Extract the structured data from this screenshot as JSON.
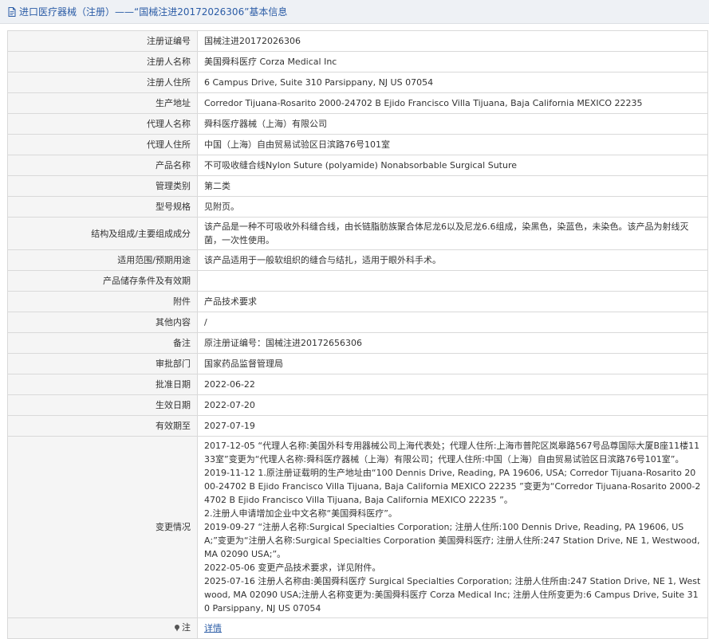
{
  "header": {
    "title": "进口医疗器械（注册）——“国械注进20172026306”基本信息"
  },
  "rows": [
    {
      "label": "注册证编号",
      "value": "国械注进20172026306"
    },
    {
      "label": "注册人名称",
      "value": "美国舜科医疗 Corza Medical Inc"
    },
    {
      "label": "注册人住所",
      "value": "6 Campus Drive, Suite 310 Parsippany, NJ US 07054"
    },
    {
      "label": "生产地址",
      "value": "Corredor Tijuana-Rosarito 2000-24702 B Ejido Francisco Villa Tijuana, Baja California MEXICO 22235"
    },
    {
      "label": "代理人名称",
      "value": "舜科医疗器械（上海）有限公司"
    },
    {
      "label": "代理人住所",
      "value": "中国（上海）自由贸易试验区日滨路76号101室"
    },
    {
      "label": "产品名称",
      "value": "不可吸收缝合线Nylon Suture (polyamide) Nonabsorbable Surgical Suture"
    },
    {
      "label": "管理类别",
      "value": "第二类"
    },
    {
      "label": "型号规格",
      "value": "见附页。"
    },
    {
      "label": "结构及组成/主要组成成分",
      "value": "该产品是一种不可吸收外科缝合线，由长链脂肪族聚合体尼龙6以及尼龙6.6组成，染黑色，染蓝色，未染色。该产品为射线灭菌，一次性使用。"
    },
    {
      "label": "适用范围/预期用途",
      "value": "该产品适用于一般软组织的缝合与结扎，适用于眼外科手术。"
    },
    {
      "label": "产品储存条件及有效期",
      "value": ""
    },
    {
      "label": "附件",
      "value": "产品技术要求"
    },
    {
      "label": "其他内容",
      "value": "/"
    },
    {
      "label": "备注",
      "value": "原注册证编号：国械注进20172656306"
    },
    {
      "label": "审批部门",
      "value": "国家药品监督管理局"
    },
    {
      "label": "批准日期",
      "value": "2022-06-22"
    },
    {
      "label": "生效日期",
      "value": "2022-07-20"
    },
    {
      "label": "有效期至",
      "value": "2027-07-19"
    }
  ],
  "changes": {
    "label": "变更情况",
    "lines": [
      "2017-12-05 “代理人名称:美国外科专用器械公司上海代表处；代理人住所:上海市普陀区岚皋路567号品尊国际大厦B座11楼1133室”变更为“代理人名称:舜科医疗器械（上海）有限公司；代理人住所:中国（上海）自由贸易试验区日滨路76号101室”。",
      "2019-11-12 1.原注册证载明的生产地址由“100 Dennis Drive, Reading, PA 19606, USA; Corredor Tijuana-Rosarito 2000-24702 B Ejido Francisco Villa Tijuana, Baja California MEXICO 22235 ”变更为“Corredor Tijuana-Rosarito 2000-24702 B Ejido Francisco Villa Tijuana, Baja California MEXICO 22235 ”。",
      "2.注册人申请增加企业中文名称“美国舜科医疗”。",
      "2019-09-27 “注册人名称:Surgical Specialties Corporation; 注册人住所:100 Dennis Drive, Reading, PA 19606, USA;”变更为“注册人名称:Surgical Specialties Corporation 美国舜科医疗; 注册人住所:247 Station Drive, NE 1, Westwood, MA 02090 USA;”。",
      "2022-05-06 变更产品技术要求，详见附件。",
      "2025-07-16 注册人名称由:美国舜科医疗 Surgical Specialties Corporation; 注册人住所由:247 Station Drive, NE 1, Westwood, MA 02090 USA;注册人名称变更为:美国舜科医疗 Corza Medical Inc; 注册人住所变更为:6 Campus Drive, Suite 310 Parsippany, NJ US 07054"
    ]
  },
  "note": {
    "label": "注",
    "link_text": "详情",
    "icon": "pin-icon"
  },
  "colors": {
    "link": "#2b5ca6",
    "label_bg": "#f5f5f5",
    "header_bg": "#eef1f5",
    "border": "#d9d9d9"
  }
}
